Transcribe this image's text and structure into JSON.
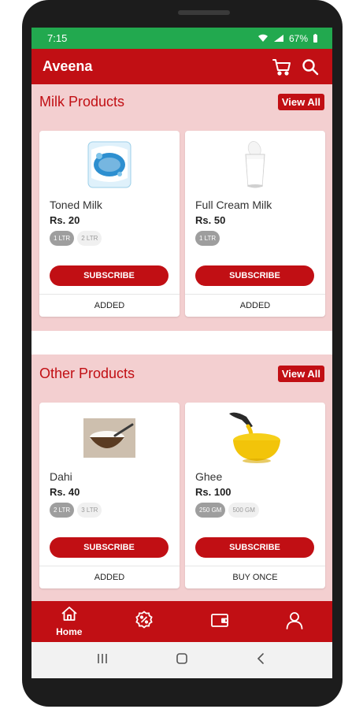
{
  "status": {
    "time": "7:15",
    "battery": "67%"
  },
  "app": {
    "title": "Aveena"
  },
  "sections": [
    {
      "title": "Milk Products",
      "view_all": "View All",
      "products": [
        {
          "name": "Toned Milk",
          "price": "Rs. 20",
          "sizes": [
            "1 LTR",
            "2 LTR"
          ],
          "selected": 0,
          "action": "SUBSCRIBE",
          "status": "ADDED"
        },
        {
          "name": "Full Cream Milk",
          "price": "Rs. 50",
          "sizes": [
            "1 LTR"
          ],
          "selected": 0,
          "action": "SUBSCRIBE",
          "status": "ADDED"
        }
      ]
    },
    {
      "title": "Other Products",
      "view_all": "View All",
      "products": [
        {
          "name": "Dahi",
          "price": "Rs. 40",
          "sizes": [
            "2 LTR",
            "3 LTR"
          ],
          "selected": 0,
          "action": "SUBSCRIBE",
          "status": "ADDED"
        },
        {
          "name": "Ghee",
          "price": "Rs. 100",
          "sizes": [
            "250 GM",
            "500 GM"
          ],
          "selected": 0,
          "action": "SUBSCRIBE",
          "status": "BUY ONCE"
        }
      ]
    }
  ],
  "bottom_nav": {
    "home_label": "Home",
    "active": "home"
  },
  "colors": {
    "brand": "#c10f14",
    "status_bar": "#22a94f",
    "section_bg": "#f3cfd0"
  },
  "icons": [
    "cart-icon",
    "search-icon",
    "home-icon",
    "offer-icon",
    "wallet-icon",
    "profile-icon"
  ]
}
